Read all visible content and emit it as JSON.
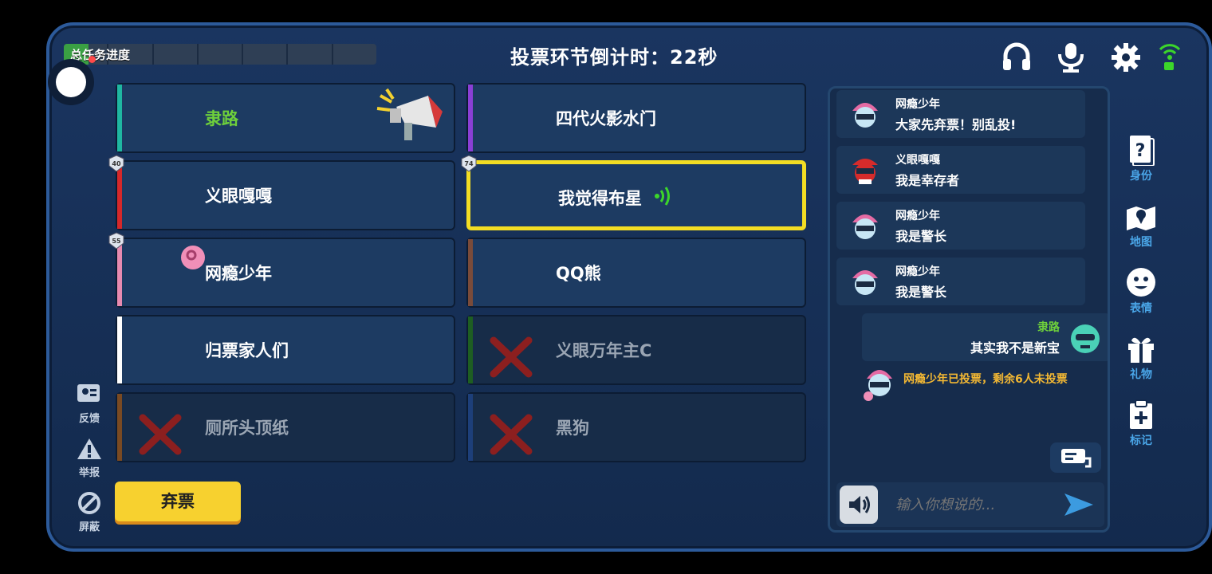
{
  "header": {
    "task_progress_label": "总任务进度",
    "task_progress_fraction": 0.08,
    "countdown": "投票环节倒计时：22秒"
  },
  "players": [
    {
      "name": "隶路",
      "name_color": "#6ed03b",
      "bar_color": "#1fb7a1",
      "dead": false
    },
    {
      "name": "四代火影水门",
      "name_color": "#ffffff",
      "bar_color": "#8a3fd6",
      "dead": false
    },
    {
      "name": "义眼嘎嘎",
      "name_color": "#ffffff",
      "bar_color": "#d6282a",
      "dead": false,
      "level": "40"
    },
    {
      "name": "我觉得布星",
      "name_color": "#ffffff",
      "bar_color": "#1d3b62",
      "dead": false,
      "level": "74",
      "voted_selected": true
    },
    {
      "name": "网瘾少年",
      "name_color": "#ffffff",
      "bar_color": "#e78ab0",
      "dead": false,
      "level": "55"
    },
    {
      "name": "QQ熊",
      "name_color": "#ffffff",
      "bar_color": "#7a4b3a",
      "dead": false
    },
    {
      "name": "归票家人们",
      "name_color": "#ffffff",
      "bar_color": "#ffffff",
      "dead": false
    },
    {
      "name": "义眼万年主C",
      "name_color": "#9aa5b3",
      "bar_color": "#1e5e22",
      "dead": true
    },
    {
      "name": "厕所头顶纸",
      "name_color": "#9aa5b3",
      "bar_color": "#7a4a22",
      "dead": true
    },
    {
      "name": "黑狗",
      "name_color": "#9aa5b3",
      "bar_color": "#1d3f7a",
      "dead": true
    }
  ],
  "left_side": {
    "feedback": "反馈",
    "report": "举报",
    "block": "屏蔽"
  },
  "abstain_label": "弃票",
  "chat": {
    "messages": [
      {
        "user": "网瘾少年",
        "text": "大家先弃票！别乱投!",
        "avatar": "pink-hat-avatar-icon"
      },
      {
        "user": "义眼嘎嘎",
        "text": "我是幸存者",
        "avatar": "red-cap-avatar-icon"
      },
      {
        "user": "网瘾少年",
        "text": "我是警长",
        "avatar": "pink-hat-avatar-icon"
      },
      {
        "user": "网瘾少年",
        "text": "我是警长",
        "avatar": "pink-hat-avatar-icon"
      }
    ],
    "self_message": {
      "user": "隶路",
      "text": "其实我不是新宝",
      "avatar": "teal-avatar-icon"
    },
    "system_message": "网瘾少年已投票，剩余6人未投票",
    "input_placeholder": "输入你想说的..."
  },
  "right_menu": {
    "identity": "身份",
    "map": "地图",
    "emote": "表情",
    "gift": "礼物",
    "mark": "标记"
  },
  "colors": {
    "accent_yellow": "#f7d12f",
    "vote_highlight": "#f3dd23",
    "self_name_green": "#6ed03b",
    "system_orange": "#f3b833"
  }
}
